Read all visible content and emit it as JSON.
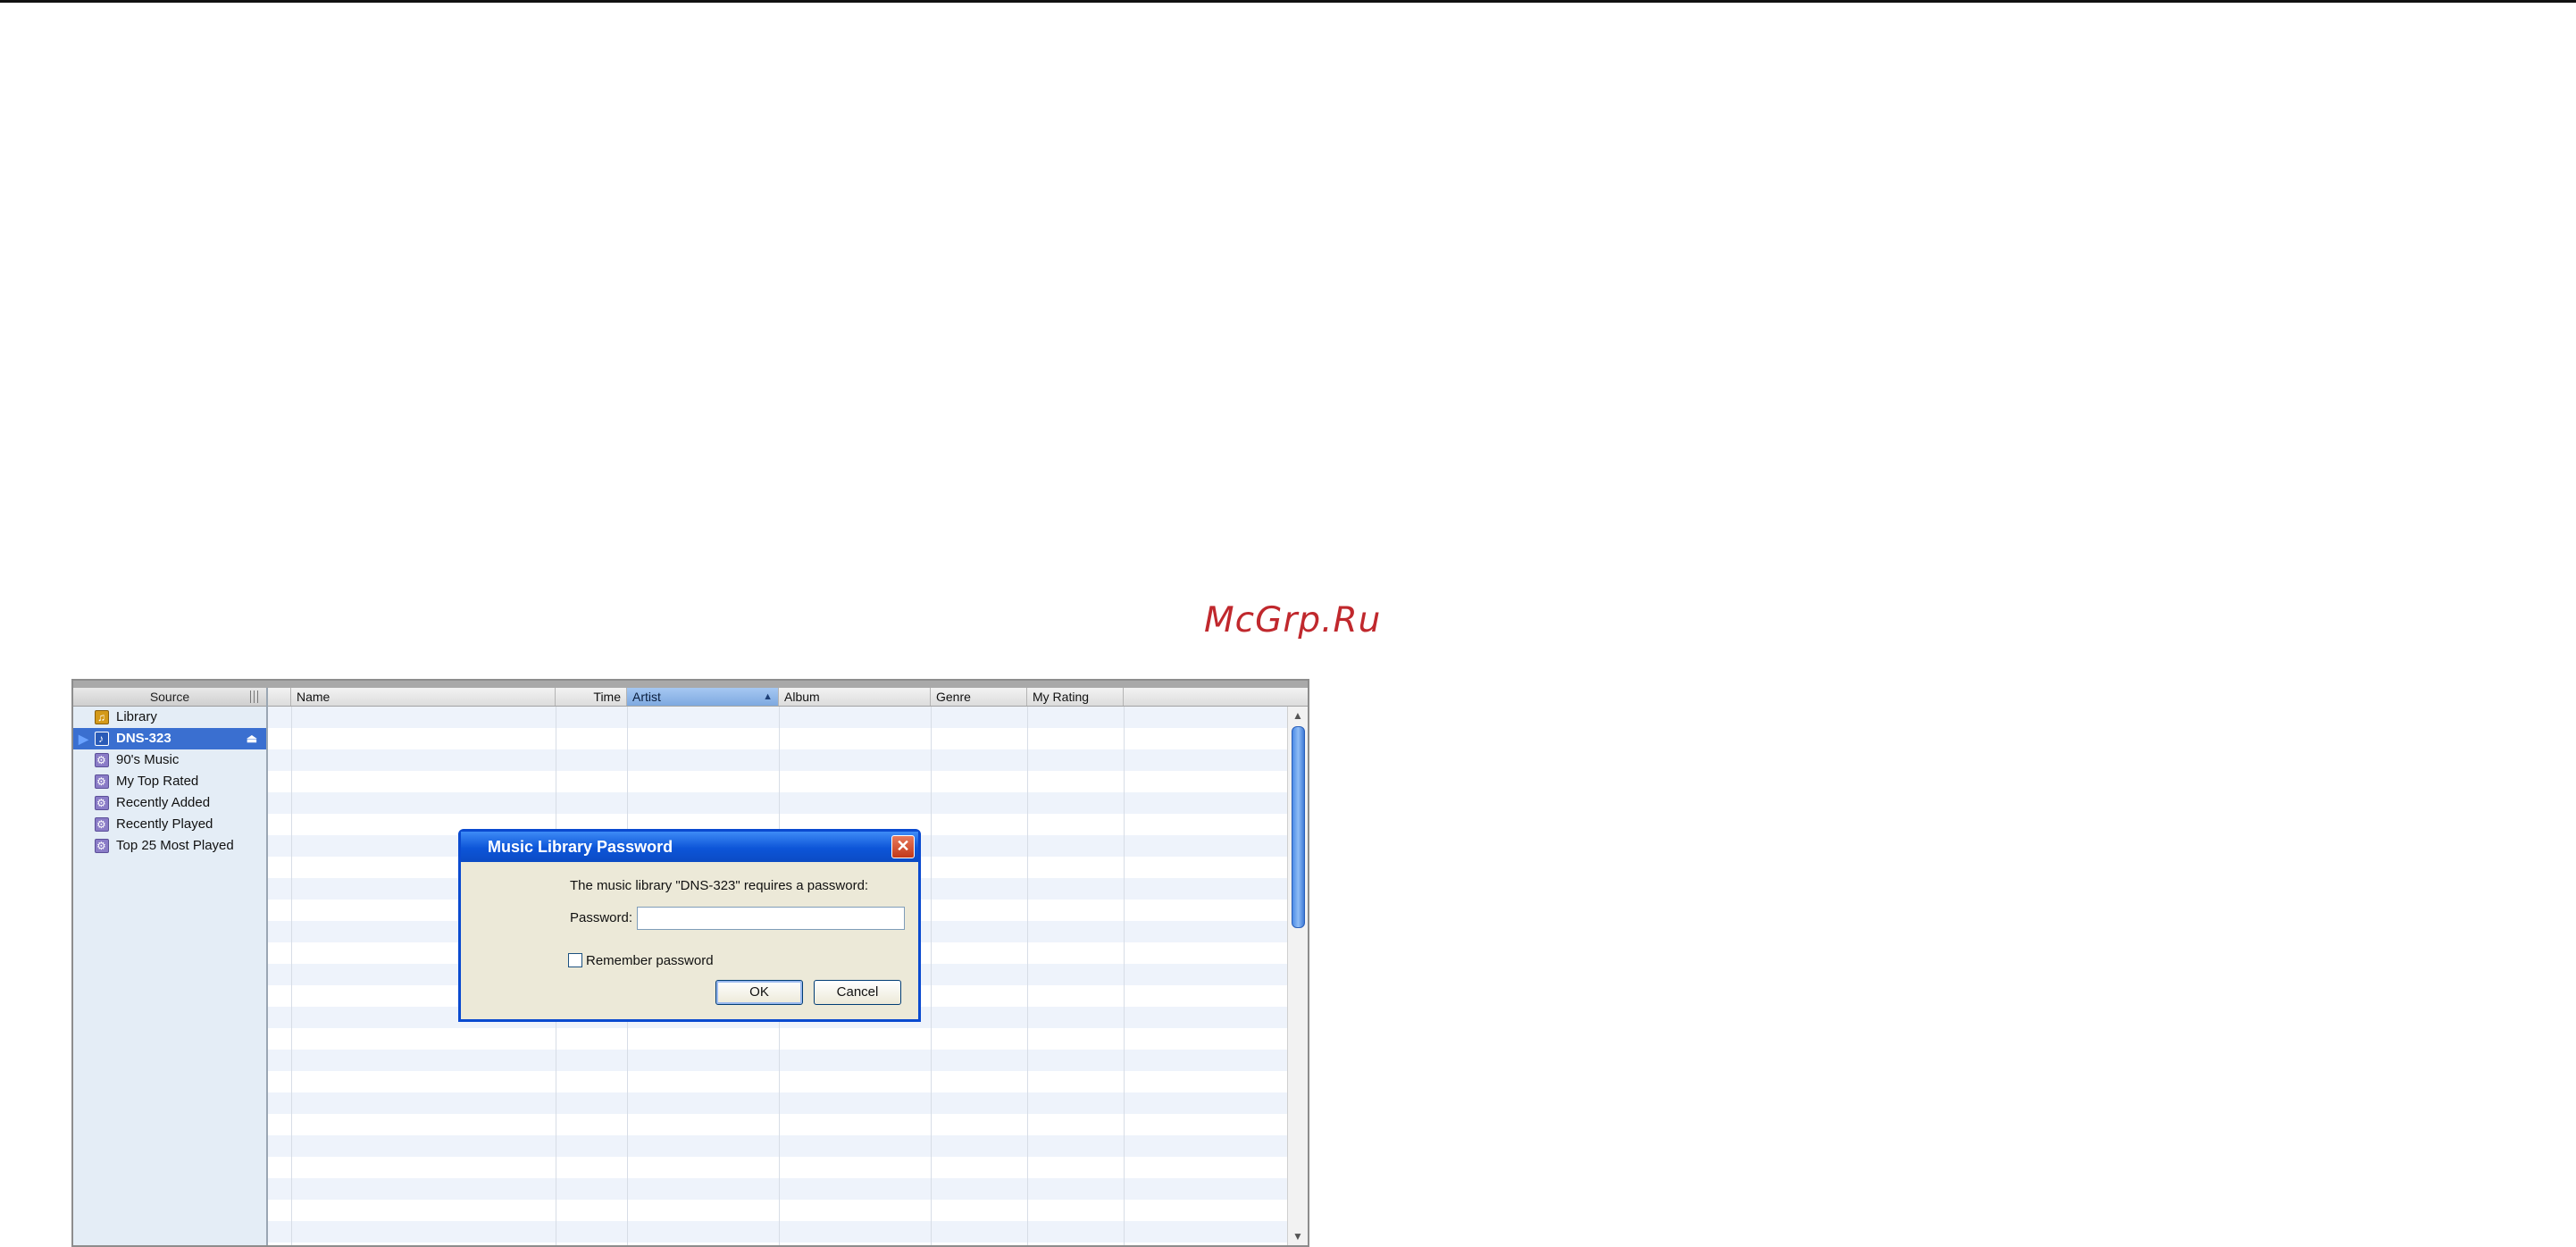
{
  "watermark": "McGrp.Ru",
  "sidebar": {
    "header": "Source",
    "items": [
      {
        "label": "Library",
        "icon": "library-icon"
      },
      {
        "label": "DNS-323",
        "icon": "shared-library-icon",
        "selected": true
      },
      {
        "label": "90's Music",
        "icon": "smart-playlist-icon"
      },
      {
        "label": "My Top Rated",
        "icon": "smart-playlist-icon"
      },
      {
        "label": "Recently Added",
        "icon": "smart-playlist-icon"
      },
      {
        "label": "Recently Played",
        "icon": "smart-playlist-icon"
      },
      {
        "label": "Top 25 Most Played",
        "icon": "smart-playlist-icon"
      }
    ]
  },
  "columns": {
    "name": "Name",
    "time": "Time",
    "artist": "Artist",
    "album": "Album",
    "genre": "Genre",
    "rating": "My Rating",
    "sorted_by": "Artist"
  },
  "dialog": {
    "title": "Music Library Password",
    "message": "The music library \"DNS-323\" requires a password:",
    "password_label": "Password:",
    "password_value": "",
    "remember_label": "Remember password",
    "remember_checked": false,
    "ok_label": "OK",
    "cancel_label": "Cancel"
  }
}
